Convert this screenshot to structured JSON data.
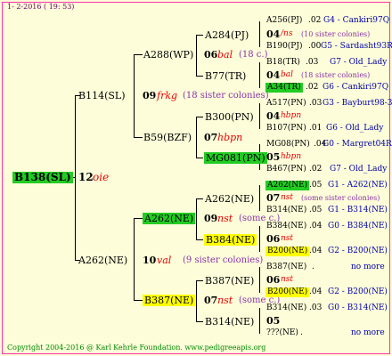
{
  "header": {
    "date": "1- 2-2016 ( 19: 53)"
  },
  "footer": {
    "copyright": "Copyright 2004-2016 @ Karl Kehrle Foundation.  www.pedigreeapis.org"
  },
  "root": {
    "name": "B138(SL)",
    "year": "12",
    "tag": "oie"
  },
  "gen1": [
    {
      "name": "B114(SL)",
      "year": "09",
      "tag": "frkg",
      "sibs": "(18 sister colonies)"
    },
    {
      "name": "A262(NE)",
      "year": "10",
      "tag": "val",
      "sibs": "(9 sister colonies)"
    }
  ],
  "gen2": [
    {
      "name": "A288(WP)",
      "year": "06",
      "tag": "bal",
      "sibs": "(18 c.)"
    },
    {
      "name": "B59(BZF)",
      "year": "07",
      "tag": "hbpn",
      "sibs": ""
    },
    {
      "name": "A262(NE)",
      "year": "09",
      "tag": "nst",
      "sibs": "(some c.)"
    },
    {
      "name": "B387(NE)",
      "year": "07",
      "tag": "nst",
      "sibs": "(some c.)"
    }
  ],
  "gen3": [
    {
      "name": "A284(PJ)",
      "year": "04",
      "tag": "/ns",
      "sibs": "(10 sister colonies)"
    },
    {
      "name": "B77(TR)",
      "year": "04",
      "tag": "bal",
      "sibs": "(18 sister colonies)"
    },
    {
      "name": "B300(PN)",
      "year": "04",
      "tag": "hbpn",
      "sibs": ""
    },
    {
      "name": "MG081(PN)",
      "year": "05",
      "tag": "hbpn",
      "sibs": ""
    },
    {
      "name": "A262(NE)",
      "year": "07",
      "tag": "nst",
      "sibs": "(some sister colonies)"
    },
    {
      "name": "B384(NE)",
      "year": "06",
      "tag": "nst",
      "sibs": ""
    },
    {
      "name": "B387(NE)",
      "year": "06",
      "tag": "nst",
      "sibs": ""
    },
    {
      "name": "B314(NE)",
      "year": "05",
      "tag": "",
      "sibs": ""
    }
  ],
  "gen4": [
    {
      "name": "A256(PJ)",
      "y": ".02",
      "code": "G4 - Cankiri97Q"
    },
    {
      "name": "B190(PJ)",
      "y": ".00",
      "code": "G5 - Sardasht93R"
    },
    {
      "name": "B18(TR)",
      "y": ".03",
      "code": "G7 - Old_Lady"
    },
    {
      "name": "A34(TR)",
      "y": ".02",
      "code": "G6 - Cankiri97Q"
    },
    {
      "name": "A517(PN)",
      "y": ".03",
      "code": "G3 - Bayburt98-3"
    },
    {
      "name": "B107(PN)",
      "y": ".01",
      "code": "G6 - Old_Lady"
    },
    {
      "name": "MG08(PN)",
      "y": ".04",
      "code": "G0 - Margret04R"
    },
    {
      "name": "B467(PN)",
      "y": ".02",
      "code": "G7 - Old_Lady"
    },
    {
      "name": "A262(NE)",
      "y": ".05",
      "code": "G1 - A262(NE)"
    },
    {
      "name": "B314(NE)",
      "y": ".05",
      "code": "G1 - B314(NE)"
    },
    {
      "name": "B384(NE)",
      "y": ".04",
      "code": "G0 - B384(NE)"
    },
    {
      "name": "B200(NE)",
      "y": ".04",
      "code": "G2 - B200(NE)"
    },
    {
      "name": "B387(NE)",
      "y": ".",
      "code": "no more"
    },
    {
      "name": "B200(NE)",
      "y": ".04",
      "code": "G2 - B200(NE)"
    },
    {
      "name": "B314(NE)",
      "y": ".03",
      "code": "G0 - B314(NE)"
    },
    {
      "name": "???(NE)",
      "y": ".",
      "code": "no more"
    }
  ]
}
